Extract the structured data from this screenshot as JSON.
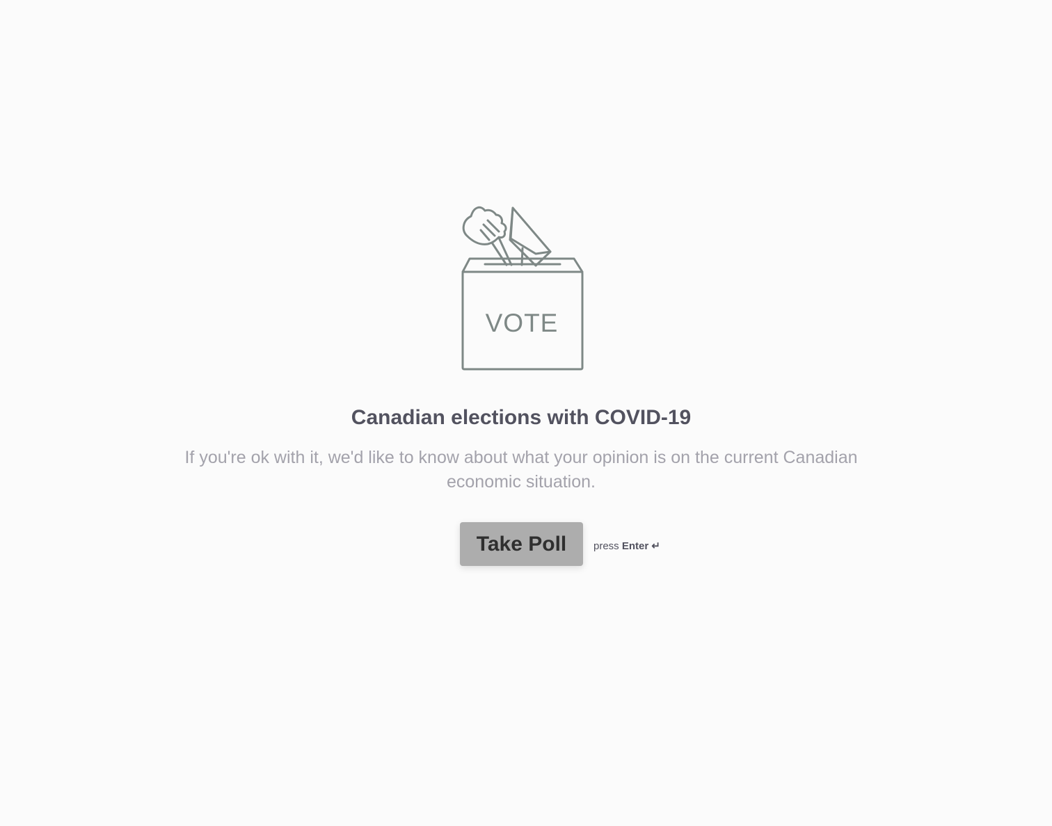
{
  "welcome_screen": {
    "illustration": {
      "icon": "ballot-box-vote-icon",
      "label": "VOTE",
      "stroke_color": "#7e8886"
    },
    "title": "Canadian elections with COVID-19",
    "description": "If you're ok with it, we'd like to know about what your opinion is on the current Canadian economic situation.",
    "start_button_label": "Take Poll",
    "hint": {
      "press_text": "press",
      "key_text": "Enter ↵"
    }
  },
  "colors": {
    "background": "#fbfbfb",
    "title": "#52525f",
    "description": "#a3a2ab",
    "button_background": "#adadad",
    "button_text": "#2f2f2f"
  }
}
